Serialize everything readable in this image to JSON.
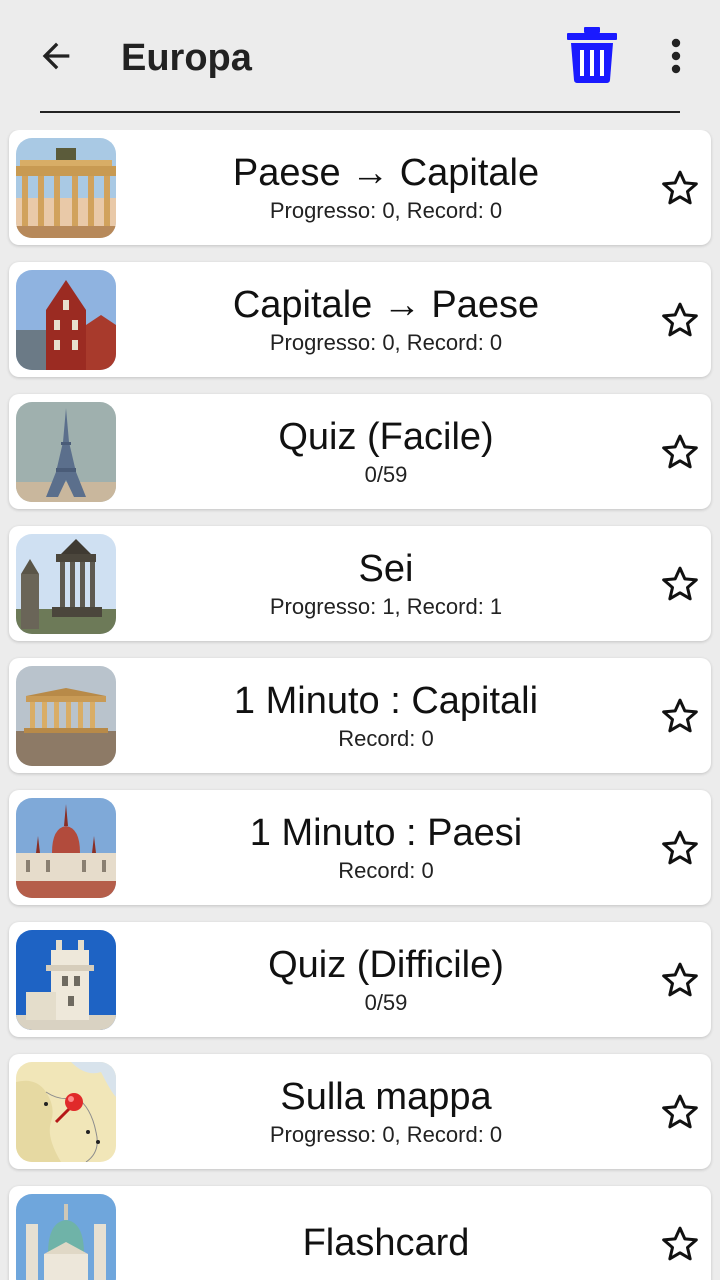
{
  "header": {
    "title": "Europa",
    "back_icon": "arrow-left-icon",
    "delete_icon": "trash-icon",
    "more_icon": "more-vertical-icon",
    "accent_color": "#1a1aff"
  },
  "items": [
    {
      "title": "Paese → Capitale",
      "subtitle": "Progresso: 0, Record: 0",
      "image": "brandenburg-gate"
    },
    {
      "title": "Capitale → Paese",
      "subtitle": "Progresso: 0, Record: 0",
      "image": "house-of-blackheads"
    },
    {
      "title": "Quiz (Facile)",
      "subtitle": "0/59",
      "image": "eiffel-tower"
    },
    {
      "title": "Sei",
      "subtitle": "Progresso: 1, Record: 1",
      "image": "dugald-stewart-monument"
    },
    {
      "title": "1 Minuto : Capitali",
      "subtitle": "Record: 0",
      "image": "parthenon"
    },
    {
      "title": "1 Minuto : Paesi",
      "subtitle": "Record: 0",
      "image": "hungarian-parliament"
    },
    {
      "title": "Quiz (Difficile)",
      "subtitle": "0/59",
      "image": "belem-tower"
    },
    {
      "title": "Sulla mappa",
      "subtitle": "Progresso: 0, Record: 0",
      "image": "map-pin"
    },
    {
      "title": "Flashcard",
      "subtitle": "",
      "image": "karlskirche"
    }
  ]
}
